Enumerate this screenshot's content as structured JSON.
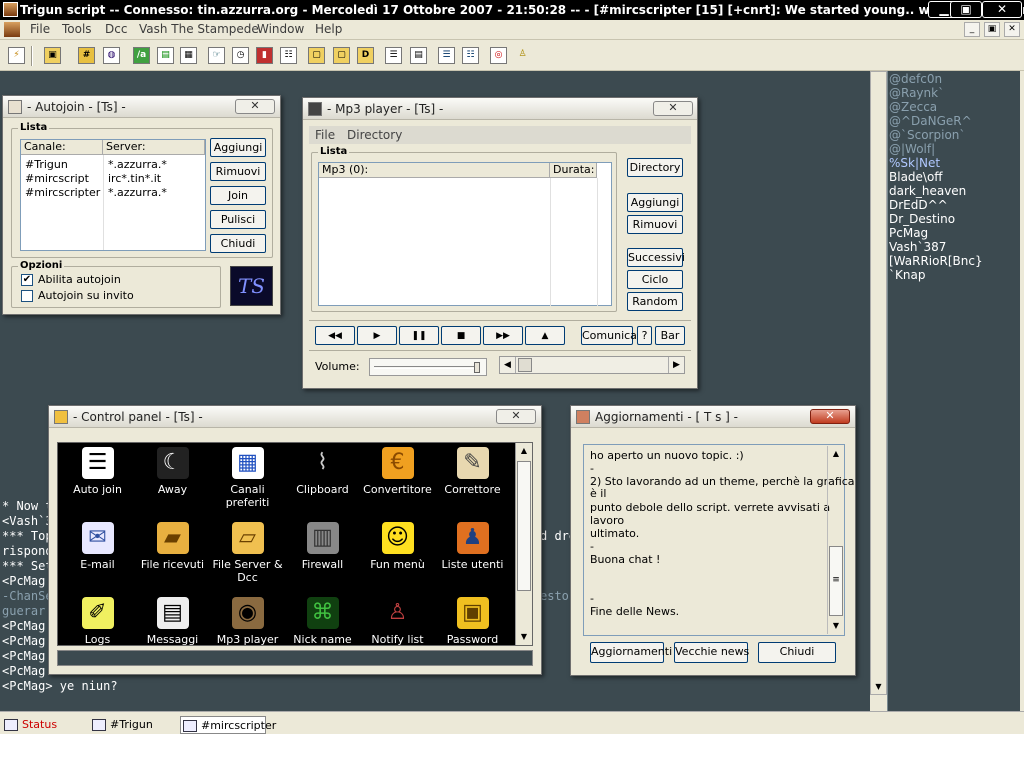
{
  "window": {
    "title": "Trigun script -- Connesso: tin.azzurra.org - Mercoledì 17 Ottobre 2007 - 21:50:28 -- - [#mircscripter [15] [+cnrt]: We started young.. we grew old.. and now w]",
    "min": "▁",
    "max": "▣",
    "close": "✕"
  },
  "menu": [
    "File",
    "Tools",
    "Dcc",
    "Vash The Stampede",
    "Window",
    "Help"
  ],
  "mdi": {
    "min": "_",
    "restore": "▣",
    "close": "✕"
  },
  "chat": [
    "* Now t",
    "<Vash`3",
    "*** Top",
    "risponde",
    "*** Set",
    "<PcMag",
    "-ChanSe",
    "  guerar",
    "<PcMag",
    "<PcMag",
    "<PcMag",
    "<PcMag",
    "<PcMag> ye niun?"
  ],
  "chat_right": [
    "d dre",
    "esto"
  ],
  "nicks": [
    {
      "name": "@defc0n",
      "color": "#8aa0ae"
    },
    {
      "name": "@Raynk`",
      "color": "#8aa0ae"
    },
    {
      "name": "@Zecca",
      "color": "#8aa0ae"
    },
    {
      "name": "@^DaNGeR^",
      "color": "#8aa0ae"
    },
    {
      "name": "@`Scorpion`",
      "color": "#8aa0ae"
    },
    {
      "name": "@|Wolf|",
      "color": "#8aa0ae"
    },
    {
      "name": "%Sk|Net",
      "color": "#b0c8ff"
    },
    {
      "name": "Blade\\off",
      "color": "#ffffff"
    },
    {
      "name": "dark_heaven",
      "color": "#ffffff"
    },
    {
      "name": "DrEdD^^",
      "color": "#ffffff"
    },
    {
      "name": "Dr_Destino",
      "color": "#ffffff"
    },
    {
      "name": "PcMag",
      "color": "#ffffff"
    },
    {
      "name": "Vash`387",
      "color": "#ffffff"
    },
    {
      "name": "[WaRRioR[Bnc}",
      "color": "#ffffff"
    },
    {
      "name": "`Knap",
      "color": "#ffffff"
    }
  ],
  "autojoin": {
    "title": "- Autojoin - [Ts] -",
    "group_list": "Lista",
    "col_channel": "Canale:",
    "col_server": "Server:",
    "rows": [
      {
        "channel": "#Trigun",
        "server": "*.azzurra.*"
      },
      {
        "channel": "#mircscript",
        "server": "irc*.tin*.it"
      },
      {
        "channel": "#mircscripter",
        "server": "*.azzurra.*"
      }
    ],
    "buttons": [
      "Aggiungi",
      "Rimuovi",
      "Join",
      "Pulisci",
      "Chiudi"
    ],
    "group_options": "Opzioni",
    "opt1": "Abilita autojoin",
    "opt2": "Autojoin su invito",
    "logo": "TS"
  },
  "mp3": {
    "title": "- Mp3 player - [Ts] -",
    "menu": [
      "File",
      "Directory"
    ],
    "group_list": "Lista",
    "col_track": "Mp3 (0):",
    "col_duration": "Durata:",
    "buttons": [
      "Directory",
      "Aggiungi",
      "Rimuovi",
      "Successivi",
      "Ciclo",
      "Random"
    ],
    "controls": [
      "◀◀",
      "▶",
      "❚❚",
      "■",
      "▶▶",
      "▲"
    ],
    "comunica": "Comunica",
    "help": "?",
    "bar": "Bar",
    "volume_label": "Volume:"
  },
  "control_panel": {
    "title": "- Control panel - [Ts] -",
    "items": [
      {
        "label": "Auto join",
        "icon": "document-icon"
      },
      {
        "label": "Away",
        "icon": "moon-icon"
      },
      {
        "label": "Canali preferiti",
        "icon": "calendar-icon"
      },
      {
        "label": "Clipboard",
        "icon": "paperclip-icon"
      },
      {
        "label": "Convertitore",
        "icon": "euro-coin-icon"
      },
      {
        "label": "Correttore",
        "icon": "notepad-icon"
      },
      {
        "label": "E-mail",
        "icon": "envelope-icon"
      },
      {
        "label": "File ricevuti",
        "icon": "folder-icon"
      },
      {
        "label": "File Server & Dcc",
        "icon": "open-folder-icon"
      },
      {
        "label": "Firewall",
        "icon": "brick-wall-icon"
      },
      {
        "label": "Fun menù",
        "icon": "smiley-icon"
      },
      {
        "label": "Liste utenti",
        "icon": "users-icon"
      },
      {
        "label": "Logs",
        "icon": "sticky-note-icon"
      },
      {
        "label": "Messaggi",
        "icon": "message-icon"
      },
      {
        "label": "Mp3 player",
        "icon": "speaker-icon"
      },
      {
        "label": "Nick name",
        "icon": "nick-icon"
      },
      {
        "label": "Notify list",
        "icon": "people-icon"
      },
      {
        "label": "Password",
        "icon": "padlock-icon"
      }
    ]
  },
  "news": {
    "title": "Aggiornamenti - [ T s ] -",
    "lines": [
      "ho aperto un nuovo topic. :)",
      "-",
      "2) Sto lavorando ad un theme, perchè la grafica",
      "è il",
      "punto debole dello script. verrete avvisati a",
      "lavoro",
      "ultimato.",
      "-",
      "Buona chat !",
      "",
      "",
      "-",
      "Fine delle News."
    ],
    "buttons": [
      "Aggiornamenti",
      "Vecchie news",
      "Chiudi"
    ]
  },
  "tabs": [
    {
      "label": "Status",
      "color": "#cc0000"
    },
    {
      "label": "#Trigun",
      "color": "#000000"
    },
    {
      "label": "#mircscripter",
      "color": "#000000"
    }
  ]
}
